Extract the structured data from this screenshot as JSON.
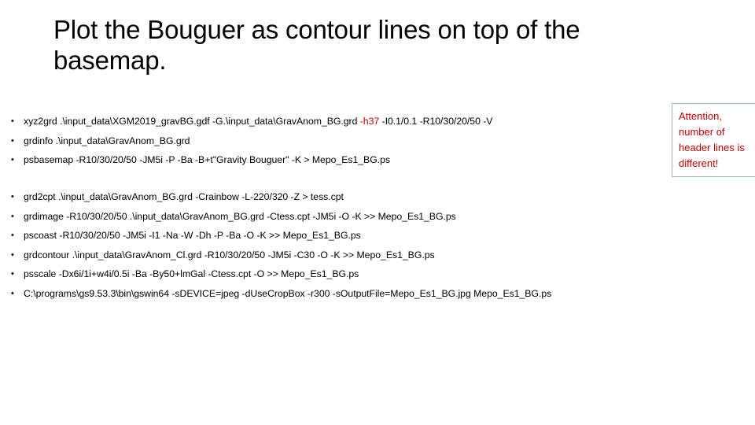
{
  "slide": {
    "title": "Plot the Bouguer as contour lines on top of the basemap.",
    "bullet_glyph": "•",
    "group_one": [
      {
        "pre": "xyz2grd .\\input_data\\XGM2019_gravBG.gdf -G.\\input_data\\GravAnom_BG.grd ",
        "highlight": "-h37",
        "post": " -I0.1/0.1 -R10/30/20/50 -V"
      },
      {
        "pre": "grdinfo .\\input_data\\GravAnom_BG.grd",
        "highlight": "",
        "post": ""
      },
      {
        "pre": "psbasemap  -R10/30/20/50 -JM5i  -P -Ba -B+t\"Gravity Bouguer\" -K > Mepo_Es1_BG.ps",
        "highlight": "",
        "post": ""
      }
    ],
    "group_two": [
      {
        "pre": "grd2cpt .\\input_data\\GravAnom_BG.grd -Crainbow -L-220/320 -Z > tess.cpt",
        "highlight": "",
        "post": ""
      },
      {
        "pre": "grdimage -R10/30/20/50 .\\input_data\\GravAnom_BG.grd -Ctess.cpt -JM5i -O -K >> Mepo_Es1_BG.ps",
        "highlight": "",
        "post": ""
      },
      {
        "pre": "pscoast -R10/30/20/50 -JM5i -I1 -Na -W -Dh -P -Ba -O -K >> Mepo_Es1_BG.ps",
        "highlight": "",
        "post": ""
      },
      {
        "pre": "grdcontour .\\input_data\\GravAnom_Cl.grd -R10/30/20/50 -JM5i -C30 -O -K >> Mepo_Es1_BG.ps",
        "highlight": "",
        "post": ""
      },
      {
        "pre": "psscale -Dx6i/1i+w4i/0.5i -Ba  -By50+lmGal  -Ctess.cpt  -O  >> Mepo_Es1_BG.ps",
        "highlight": "",
        "post": ""
      },
      {
        "pre": "C:\\programs\\gs9.53.3\\bin\\gswin64 -sDEVICE=jpeg -dUseCropBox -r300 -sOutputFile=Mepo_Es1_BG.jpg  Mepo_Es1_BG.ps",
        "highlight": "",
        "post": ""
      }
    ],
    "callout": {
      "text": "Attention, number of header lines is different!",
      "border_color": "#9ab7c6",
      "text_color": "#c00000"
    },
    "colors": {
      "highlight_red": "#c00000",
      "text_black": "#000000",
      "background": "#ffffff"
    }
  }
}
